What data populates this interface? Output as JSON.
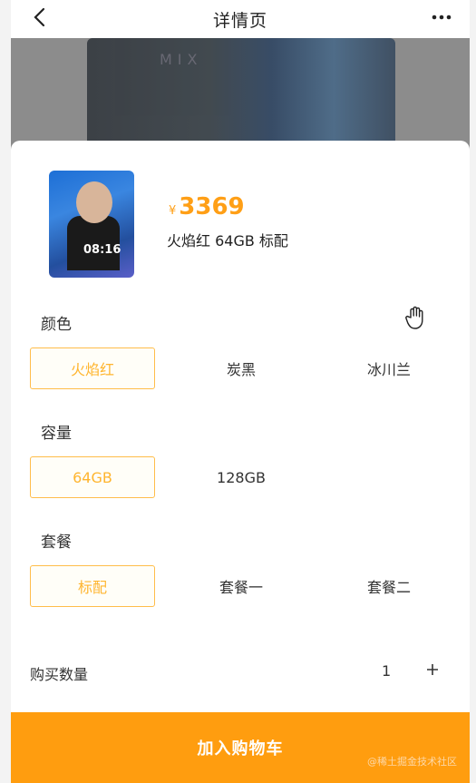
{
  "navbar": {
    "title": "详情页",
    "back_icon": "chevron-left-icon",
    "more_icon": "more-horizontal-icon"
  },
  "background": {
    "logo_text": "MIX"
  },
  "product": {
    "price_symbol": "¥",
    "price": "3369",
    "selected_spec": "火焰红 64GB 标配",
    "thumb_time": "08:16"
  },
  "specs": {
    "color": {
      "label": "颜色",
      "options": [
        "火焰红",
        "炭黑",
        "冰川兰"
      ],
      "selected": "火焰红"
    },
    "capacity": {
      "label": "容量",
      "options": [
        "64GB",
        "128GB"
      ],
      "selected": "64GB"
    },
    "package": {
      "label": "套餐",
      "options": [
        "标配",
        "套餐一",
        "套餐二"
      ],
      "selected": "标配"
    }
  },
  "quantity": {
    "label": "购买数量",
    "value": "1",
    "plus_icon": "plus-icon"
  },
  "cart_button": {
    "label": "加入购物车"
  },
  "watermark": "@稀土掘金技术社区",
  "colors": {
    "accent": "#ff9d0f",
    "price": "#ff9f16",
    "selected_border": "#ffbd4a"
  }
}
